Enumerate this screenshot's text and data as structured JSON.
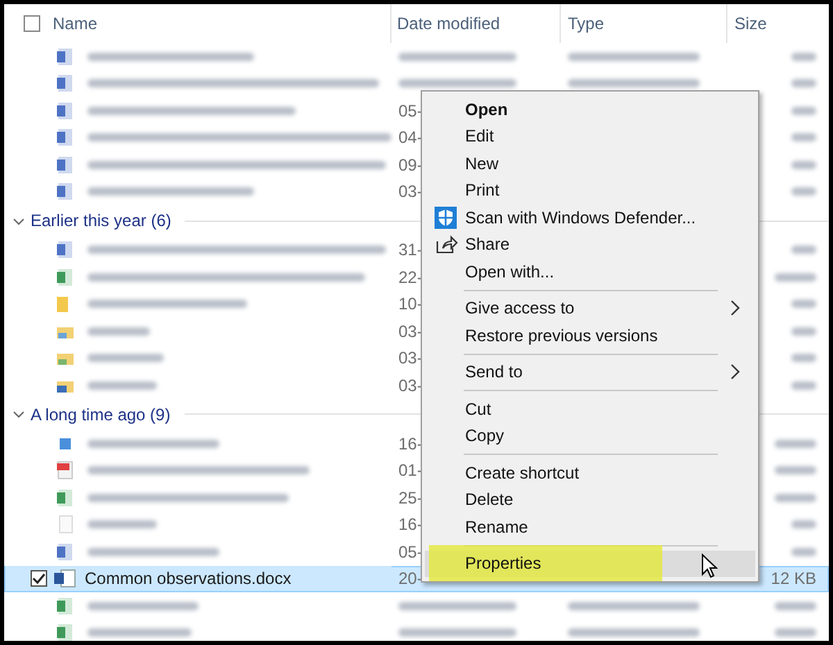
{
  "select_all": {
    "checked": false
  },
  "columns": [
    "Name",
    "Date modified",
    "Type",
    "Size"
  ],
  "groups": [
    {
      "rows": [
        {
          "kind": "doc",
          "selected": false
        },
        {
          "kind": "doc",
          "selected": false
        },
        {
          "kind": "doc",
          "date": "05-",
          "selected": false
        },
        {
          "kind": "doc",
          "date": "04-",
          "selected": false
        },
        {
          "kind": "doc",
          "date": "09-",
          "selected": false
        },
        {
          "kind": "doc",
          "date": "03-",
          "selected": false
        }
      ]
    },
    {
      "label": "Earlier this year (6)",
      "expanded": true,
      "rows": [
        {
          "kind": "doc",
          "date": "31-",
          "selected": false
        },
        {
          "kind": "sheet",
          "date": "22-",
          "selected": false
        },
        {
          "kind": "folder",
          "date": "10-",
          "selected": false
        },
        {
          "kind": "music",
          "date": "03-",
          "selected": false
        },
        {
          "kind": "pictures",
          "date": "03-",
          "selected": false
        },
        {
          "kind": "videos",
          "date": "03-",
          "selected": false
        }
      ]
    },
    {
      "label": "A long time ago (9)",
      "expanded": true,
      "rows": [
        {
          "kind": "video",
          "date": "16-",
          "selected": false
        },
        {
          "kind": "pdf",
          "date": "01-",
          "selected": false
        },
        {
          "kind": "sheet",
          "date": "25-",
          "selected": false
        },
        {
          "kind": "ini",
          "date": "16-",
          "selected": false
        },
        {
          "kind": "doc",
          "date": "05-",
          "selected": false
        },
        {
          "kind": "word",
          "name": "Common observations.docx",
          "date": "20-",
          "size": "12 KB",
          "selected": true
        },
        {
          "kind": "sheet",
          "selected": false
        },
        {
          "kind": "sheet",
          "selected": false
        }
      ]
    }
  ],
  "context_menu": [
    {
      "kind": "item",
      "label": "Open",
      "bold": true,
      "selected": false
    },
    {
      "kind": "item",
      "label": "Edit",
      "selected": false
    },
    {
      "kind": "item",
      "label": "New",
      "selected": false
    },
    {
      "kind": "item",
      "label": "Print",
      "selected": false
    },
    {
      "kind": "scan",
      "label": "Scan with Windows Defender...",
      "selected": false
    },
    {
      "kind": "share",
      "label": "Share",
      "selected": false
    },
    {
      "kind": "item",
      "label": "Open with...",
      "selected": false
    },
    {
      "kind": "separator"
    },
    {
      "kind": "item",
      "label": "Give access to",
      "submenu": true,
      "selected": false
    },
    {
      "kind": "item",
      "label": "Restore previous versions",
      "selected": false
    },
    {
      "kind": "separator"
    },
    {
      "kind": "item",
      "label": "Send to",
      "submenu": true,
      "selected": false
    },
    {
      "kind": "separator"
    },
    {
      "kind": "item",
      "label": "Cut",
      "selected": false
    },
    {
      "kind": "item",
      "label": "Copy",
      "selected": false
    },
    {
      "kind": "separator"
    },
    {
      "kind": "item",
      "label": "Create shortcut",
      "selected": false
    },
    {
      "kind": "item",
      "label": "Delete",
      "selected": false
    },
    {
      "kind": "item",
      "label": "Rename",
      "selected": false
    },
    {
      "kind": "separator"
    },
    {
      "kind": "item",
      "label": "Properties",
      "selected": true,
      "highlighted": true
    }
  ]
}
